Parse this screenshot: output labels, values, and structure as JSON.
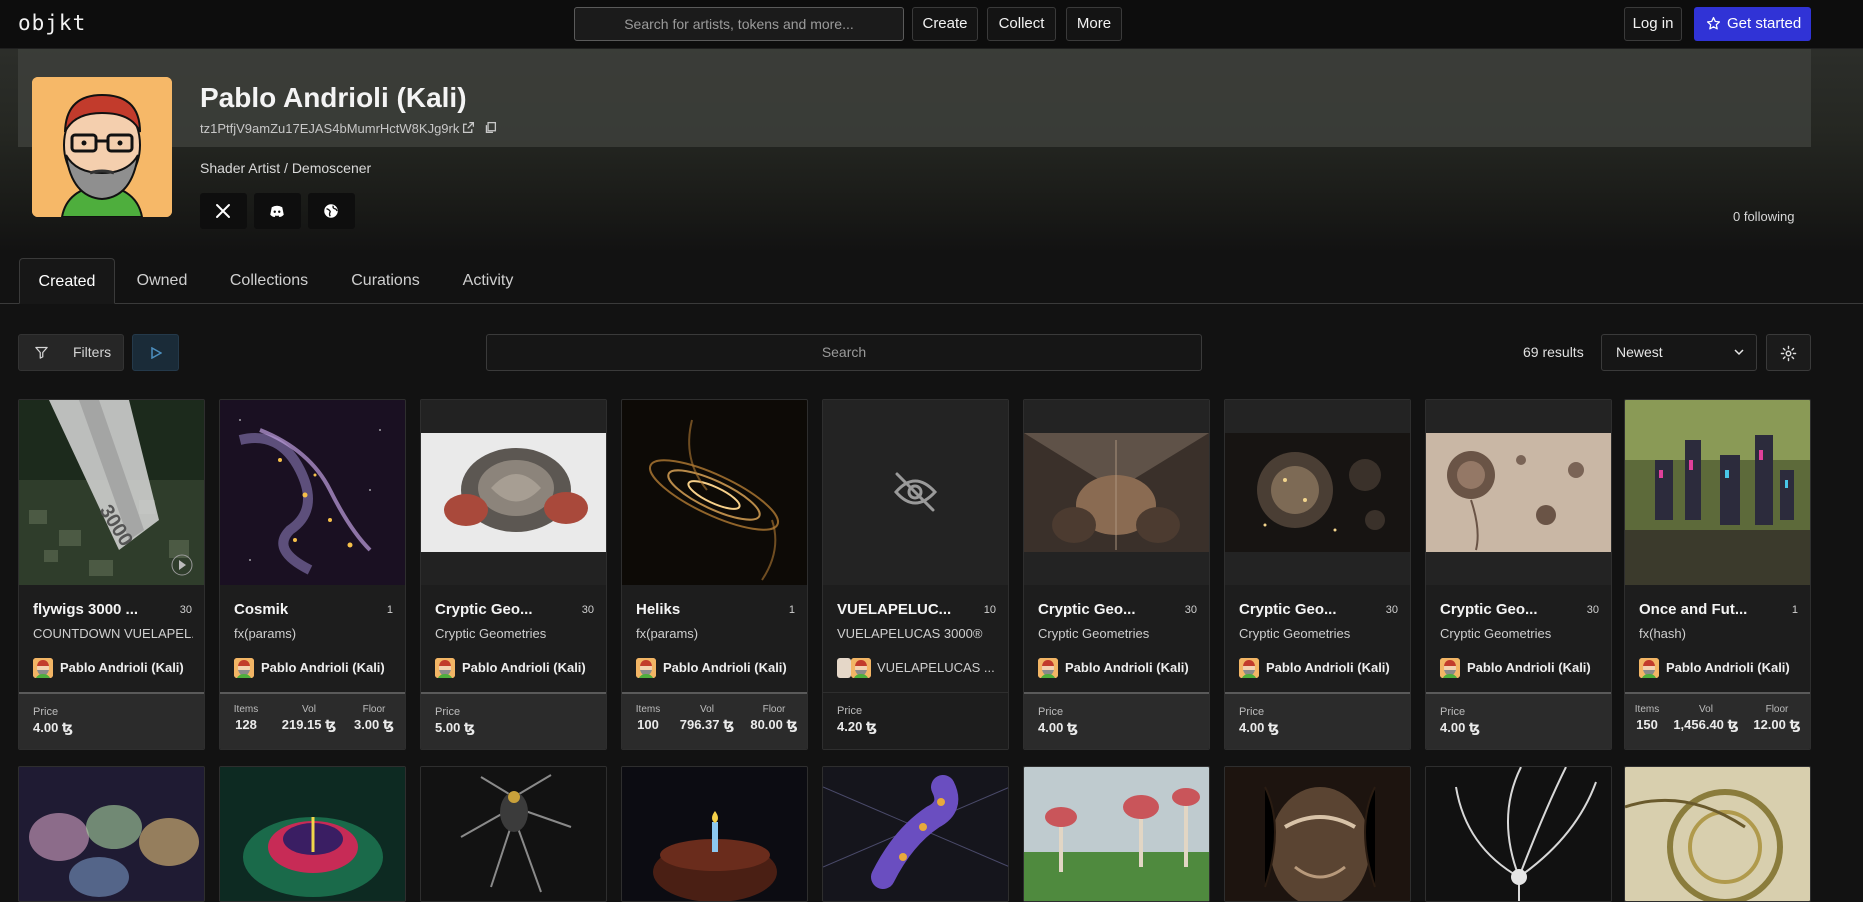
{
  "nav": {
    "logo": "objkt",
    "search_placeholder": "Search for artists, tokens and more...",
    "create": "Create",
    "collect": "Collect",
    "more": "More",
    "login": "Log in",
    "get_started": "Get started"
  },
  "profile": {
    "name": "Pablo Andrioli (Kali)",
    "address": "tz1PtfjV9amZu17EJAS4bMumrHctW8KJg9rk",
    "bio": "Shader Artist / Demoscener",
    "following": "0 following"
  },
  "tabs": [
    "Created",
    "Owned",
    "Collections",
    "Curations",
    "Activity"
  ],
  "toolbar": {
    "filters": "Filters",
    "search_placeholder": "Search",
    "results": "69 results",
    "sort": "Newest"
  },
  "cards": [
    {
      "title": "flywigs 3000 ...",
      "edition": "30",
      "collection": "COUNTDOWN VUELAPEL...",
      "artist": "Pablo Andrioli (Kali)",
      "price_label": "Price",
      "price": "4.00 ꜩ"
    },
    {
      "title": "Cosmik",
      "edition": "1",
      "collection": "fx(params)",
      "artist": "Pablo Andrioli (Kali)",
      "stats": {
        "items_label": "Items",
        "items": "128",
        "vol_label": "Vol",
        "vol": "219.15 ꜩ",
        "floor_label": "Floor",
        "floor": "3.00 ꜩ"
      }
    },
    {
      "title": "Cryptic Geo...",
      "edition": "30",
      "collection": "Cryptic Geometries",
      "artist": "Pablo Andrioli (Kali)",
      "price_label": "Price",
      "price": "5.00 ꜩ"
    },
    {
      "title": "Heliks",
      "edition": "1",
      "collection": "fx(params)",
      "artist": "Pablo Andrioli (Kali)",
      "stats": {
        "items_label": "Items",
        "items": "100",
        "vol_label": "Vol",
        "vol": "796.37 ꜩ",
        "floor_label": "Floor",
        "floor": "80.00 ꜩ"
      }
    },
    {
      "title": "VUELAPELUC...",
      "edition": "10",
      "collection": "VUELAPELUCAS 3000®",
      "artist": "VUELAPELUCAS ...",
      "price_label": "Price",
      "price": "4.20 ꜩ"
    },
    {
      "title": "Cryptic Geo...",
      "edition": "30",
      "collection": "Cryptic Geometries",
      "artist": "Pablo Andrioli (Kali)",
      "price_label": "Price",
      "price": "4.00 ꜩ"
    },
    {
      "title": "Cryptic Geo...",
      "edition": "30",
      "collection": "Cryptic Geometries",
      "artist": "Pablo Andrioli (Kali)",
      "price_label": "Price",
      "price": "4.00 ꜩ"
    },
    {
      "title": "Cryptic Geo...",
      "edition": "30",
      "collection": "Cryptic Geometries",
      "artist": "Pablo Andrioli (Kali)",
      "price_label": "Price",
      "price": "4.00 ꜩ"
    },
    {
      "title": "Once and Fut...",
      "edition": "1",
      "collection": "fx(hash)",
      "artist": "Pablo Andrioli (Kali)",
      "stats": {
        "items_label": "Items",
        "items": "150",
        "vol_label": "Vol",
        "vol": "1,456.40 ꜩ",
        "floor_label": "Floor",
        "floor": "12.00 ꜩ"
      }
    }
  ],
  "colors": {
    "accent": "#3033d6",
    "background": "#121212",
    "card": "#1d1d1d"
  }
}
